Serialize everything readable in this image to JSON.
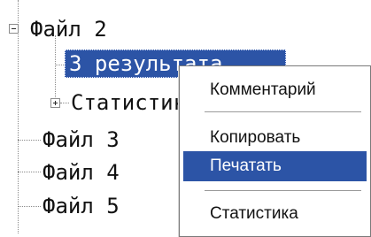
{
  "tree": {
    "nodes": [
      {
        "label": "Файл 2",
        "expander": "minus"
      },
      {
        "label": "3 результата",
        "selected": true
      },
      {
        "label": "Статистика",
        "expander": "plus"
      },
      {
        "label": "Файл 3"
      },
      {
        "label": "Файл 4"
      },
      {
        "label": "Файл 5"
      }
    ]
  },
  "context_menu": {
    "items": [
      {
        "label": "Комментарий"
      },
      {
        "label": "Копировать"
      },
      {
        "label": "Печатать",
        "active": true
      },
      {
        "label": "Статистика"
      }
    ],
    "highlight_color": "#2c54a6"
  }
}
